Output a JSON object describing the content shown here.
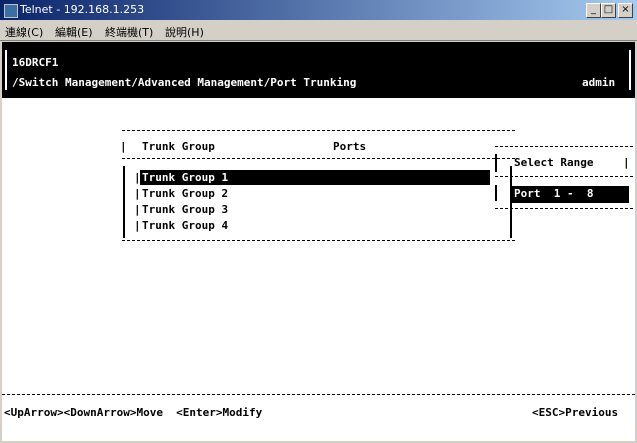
{
  "window": {
    "title": "Telnet - 192.168.1.253"
  },
  "menu": {
    "items": [
      "連線(C)",
      "編輯(E)",
      "終端機(T)",
      "說明(H)"
    ]
  },
  "header": {
    "device": "16DRCF1",
    "path": "/Switch Management/Advanced Management/Port Trunking",
    "user": "admin"
  },
  "table": {
    "col_group": "Trunk Group",
    "col_ports": "Ports",
    "rows": [
      "Trunk Group 1",
      "Trunk Group 2",
      "Trunk Group 3",
      "Trunk Group 4"
    ],
    "selected_index": 0
  },
  "range": {
    "title": "Select Range",
    "value": "Port  1 -  8"
  },
  "footer": {
    "nav_hint": "<UpArrow><DownArrow>Move  <Enter>Modify",
    "esc_hint": "<ESC>Previous"
  }
}
